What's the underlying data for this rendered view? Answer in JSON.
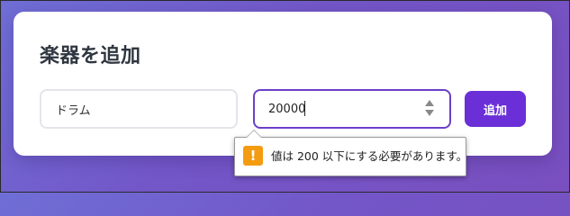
{
  "form": {
    "title": "楽器を追加",
    "instrument_name_value": "ドラム",
    "price_value": "20000",
    "add_button_label": "追加"
  },
  "validation": {
    "icon": "warning-icon",
    "icon_glyph": "!",
    "message": "値は 200 以下にする必要があります。"
  },
  "colors": {
    "accent": "#6a2fd6",
    "warning": "#f39c12"
  }
}
